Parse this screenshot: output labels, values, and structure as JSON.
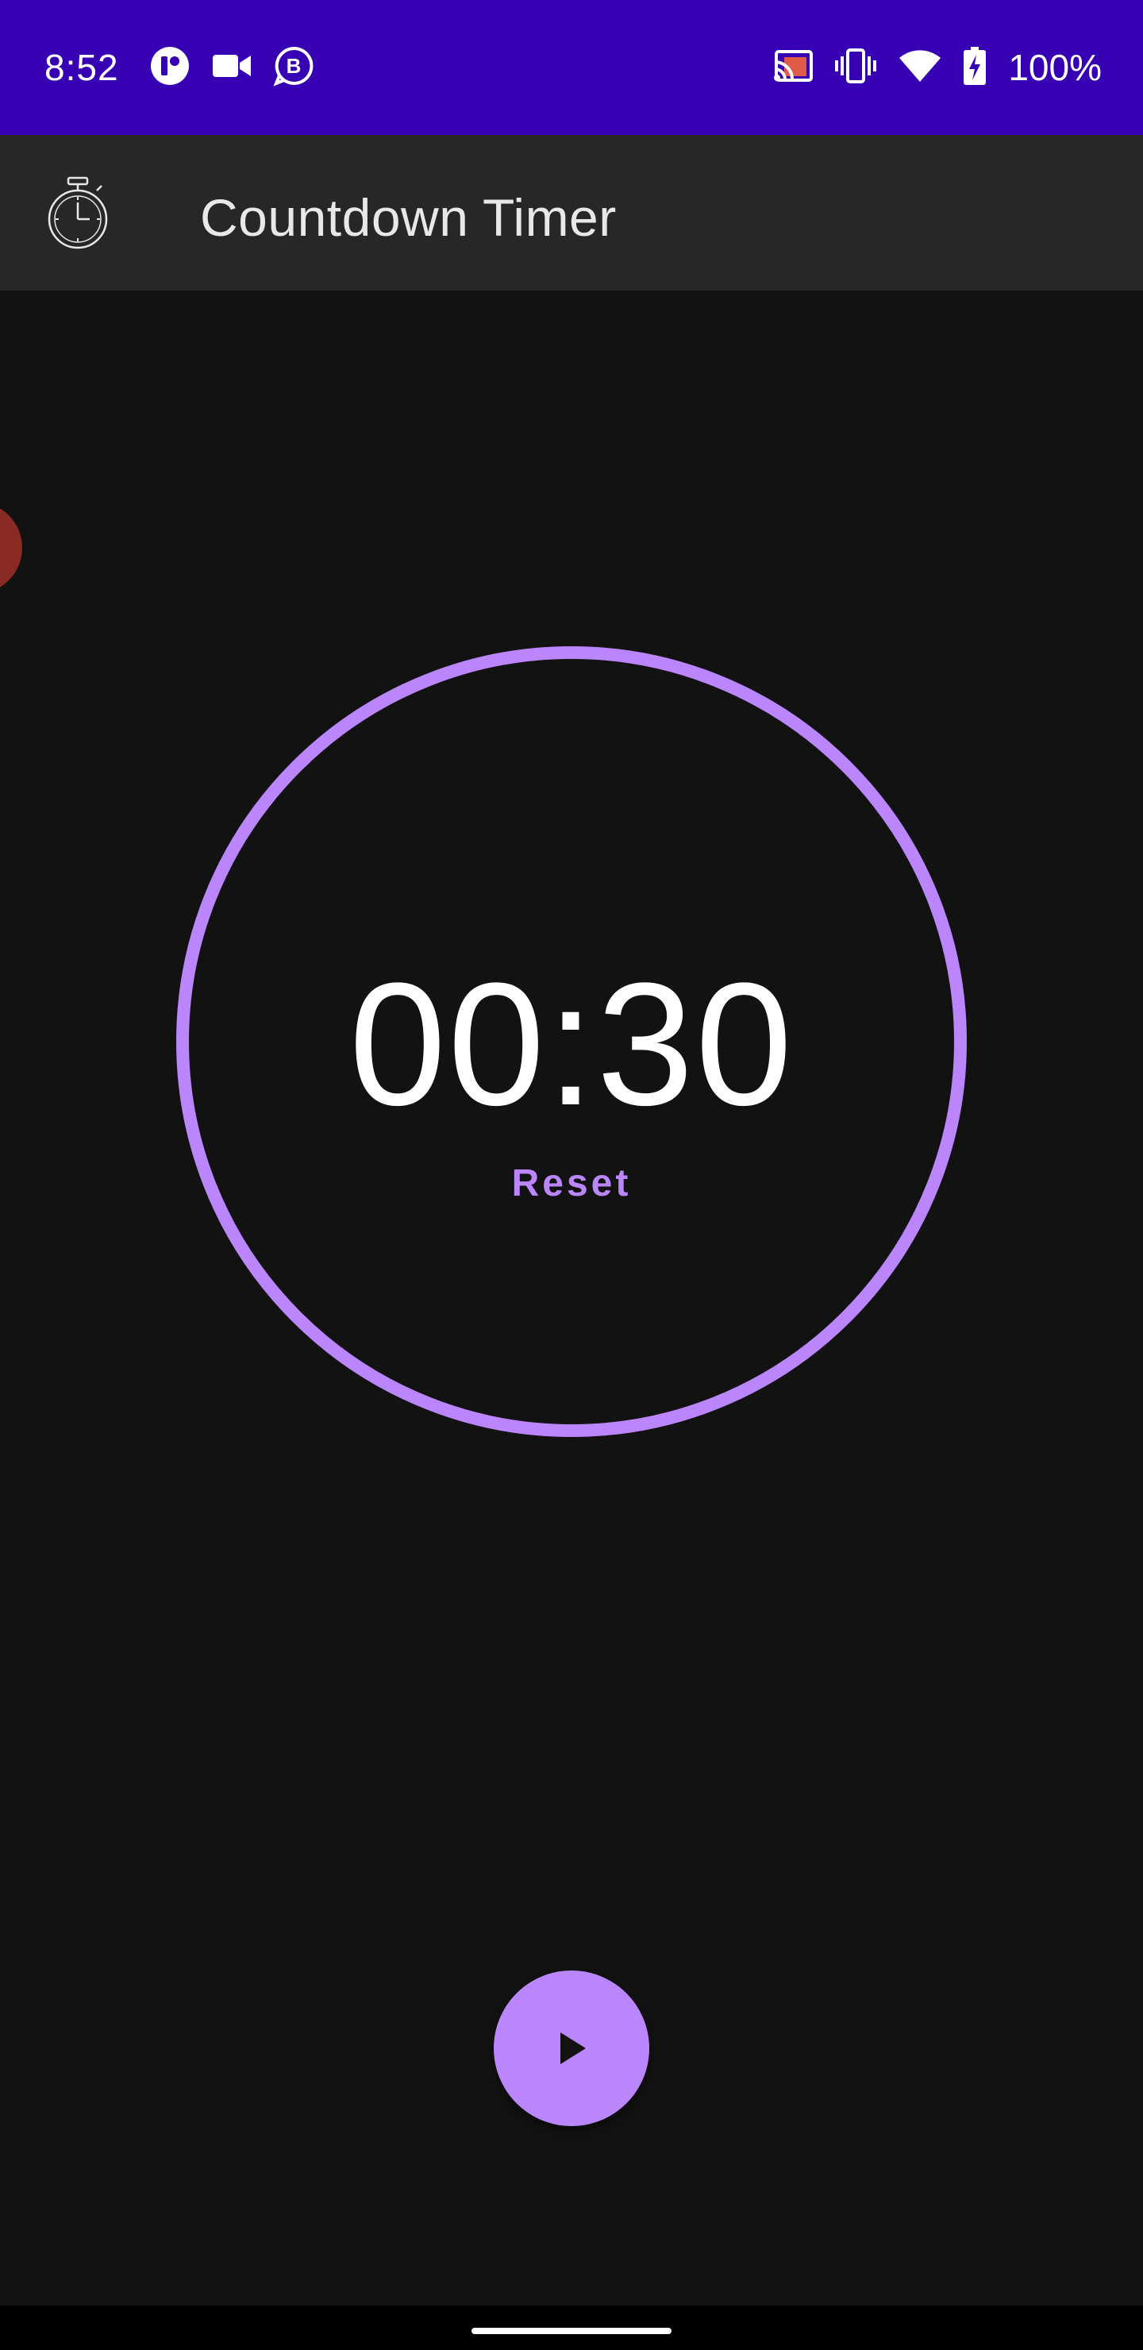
{
  "status_bar": {
    "time": "8:52",
    "battery": "100%",
    "background_color": "#3700b3",
    "left_icons": [
      "custom-app-icon",
      "video-camera-icon",
      "business-chat-icon"
    ],
    "right_icons": [
      "cast-icon",
      "vibrate-icon",
      "wifi-icon",
      "battery-charging-icon"
    ]
  },
  "app_bar": {
    "title": "Countdown Timer",
    "icon": "stopwatch-icon",
    "background_color": "#272727"
  },
  "timer": {
    "display": "00:30",
    "reset_label": "Reset",
    "progress": 1.0,
    "accent_color": "#bb86fc"
  },
  "fab": {
    "icon": "play-icon",
    "color": "#bb86fc"
  },
  "floating_bubble": {
    "color": "#8a2a24"
  }
}
